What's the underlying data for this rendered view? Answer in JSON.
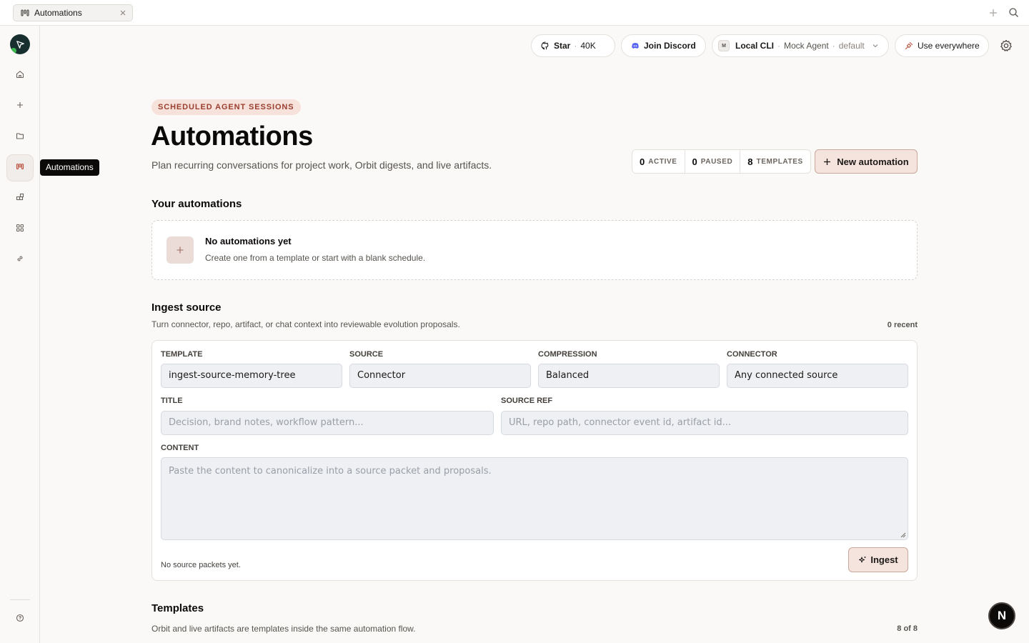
{
  "tabbar": {
    "tab_label": "Automations",
    "tab_icon": "automations-icon",
    "actions": [
      "plus-icon",
      "search-icon"
    ]
  },
  "sidebar": {
    "items": [
      {
        "icon": "home-icon"
      },
      {
        "icon": "plus-icon"
      },
      {
        "icon": "folder-icon"
      },
      {
        "icon": "automations-icon",
        "active": true
      },
      {
        "icon": "plugins-icon"
      },
      {
        "icon": "apps-grid-icon"
      },
      {
        "icon": "link-icon"
      },
      {
        "icon": "help-icon"
      }
    ],
    "tooltip": "Automations"
  },
  "header": {
    "star": {
      "label": "Star",
      "count": "40K"
    },
    "discord": {
      "label": "Join Discord"
    },
    "agent": {
      "cli": "Local CLI",
      "agent": "Mock Agent",
      "profile": "default"
    },
    "use_everywhere": "Use everywhere"
  },
  "page": {
    "eyebrow": "SCHEDULED AGENT SESSIONS",
    "title": "Automations",
    "subtitle": "Plan recurring conversations for project work, Orbit digests, and live artifacts.",
    "stats": [
      {
        "value": "0",
        "label": "ACTIVE"
      },
      {
        "value": "0",
        "label": "PAUSED"
      },
      {
        "value": "8",
        "label": "TEMPLATES"
      }
    ],
    "new_button": "New automation"
  },
  "your_automations": {
    "heading": "Your automations",
    "empty_title": "No automations yet",
    "empty_sub": "Create one from a template or start with a blank schedule."
  },
  "ingest": {
    "heading": "Ingest source",
    "subtitle": "Turn connector, repo, artifact, or chat context into reviewable evolution proposals.",
    "recent": "0 recent",
    "fields": {
      "template": {
        "label": "TEMPLATE",
        "value": "ingest-source-memory-tree"
      },
      "source": {
        "label": "SOURCE",
        "value": "Connector"
      },
      "compression": {
        "label": "COMPRESSION",
        "value": "Balanced"
      },
      "connector": {
        "label": "CONNECTOR",
        "value": "Any connected source"
      },
      "title": {
        "label": "TITLE",
        "placeholder": "Decision, brand notes, workflow pattern..."
      },
      "source_ref": {
        "label": "SOURCE REF",
        "placeholder": "URL, repo path, connector event id, artifact id..."
      },
      "content": {
        "label": "CONTENT",
        "placeholder": "Paste the content to canonicalize into a source packet and proposals."
      }
    },
    "footer": "No source packets yet.",
    "button": "Ingest"
  },
  "templates": {
    "heading": "Templates",
    "subtitle": "Orbit and live artifacts are templates inside the same automation flow.",
    "count": "8 of 8"
  },
  "fab": {
    "label": "N"
  },
  "colors": {
    "accent": "#f5e3dd",
    "accent_border": "#c9a79c",
    "eyebrow_text": "#9a3f2e",
    "logo_bg": "#17302f"
  }
}
